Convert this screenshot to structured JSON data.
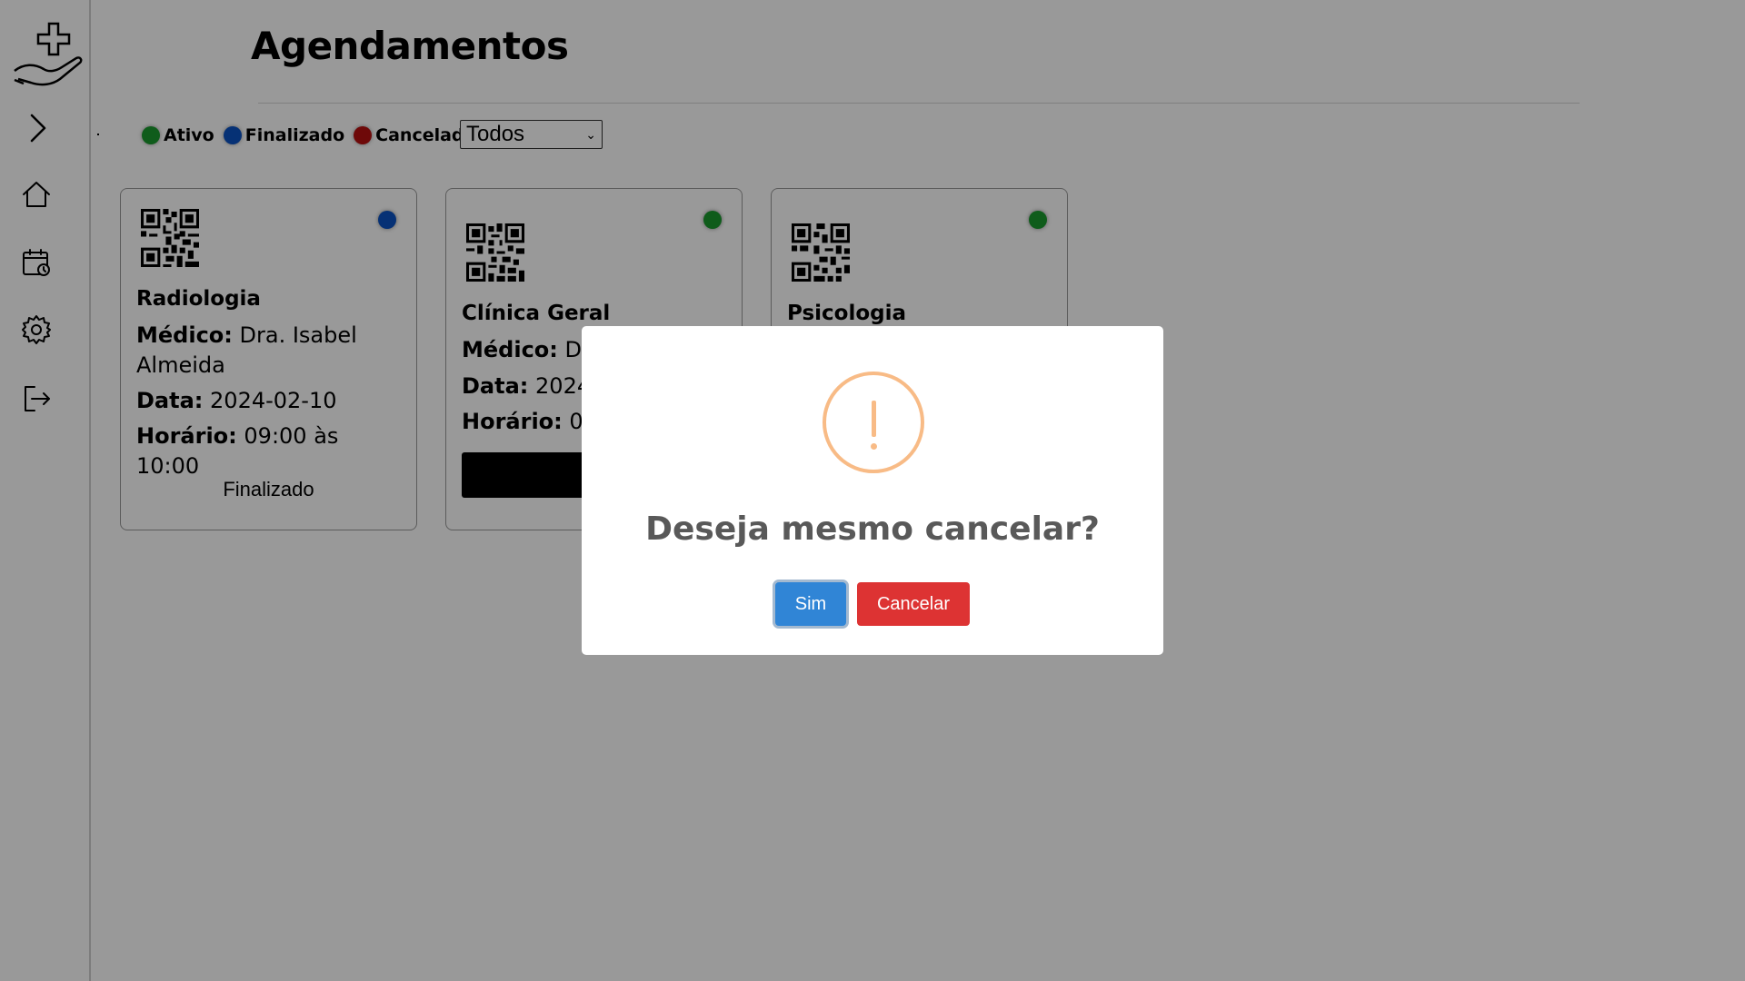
{
  "page": {
    "title": "Agendamentos"
  },
  "legend": [
    {
      "label": "Ativo",
      "color": "#1a9a2e"
    },
    {
      "label": "Finalizado",
      "color": "#0a52c4"
    },
    {
      "label": "Cancelado",
      "color": "#b80f0f"
    }
  ],
  "filter": {
    "selected": "Todos"
  },
  "cards": [
    {
      "specialty": "Radiologia",
      "doctor_label": "Médico:",
      "doctor": "Dra. Isabel Almeida",
      "date_label": "Data:",
      "date": "2024-02-10",
      "time_label": "Horário:",
      "time": "09:00 às 10:00",
      "status_text": "Finalizado",
      "status_color": "#0a52c4"
    },
    {
      "specialty": "Clínica Geral",
      "doctor_label": "Médico:",
      "doctor": "Dr.",
      "date_label": "Data:",
      "date": "2024-",
      "time_label": "Horário:",
      "time": "08",
      "button_label": "Ca",
      "status_color": "#1a9a2e"
    },
    {
      "specialty": "Psicologia",
      "status_color": "#1a9a2e"
    }
  ],
  "modal": {
    "title": "Deseja mesmo cancelar?",
    "confirm_label": "Sim",
    "cancel_label": "Cancelar",
    "icon": "warning-icon",
    "icon_color": "#f8bb86",
    "confirm_color": "#3085d6",
    "cancel_color": "#dd3333"
  },
  "sidebar": {
    "items": [
      {
        "icon": "expand-chevron-icon"
      },
      {
        "icon": "home-icon"
      },
      {
        "icon": "calendar-icon"
      },
      {
        "icon": "gear-icon"
      },
      {
        "icon": "logout-icon"
      }
    ]
  }
}
